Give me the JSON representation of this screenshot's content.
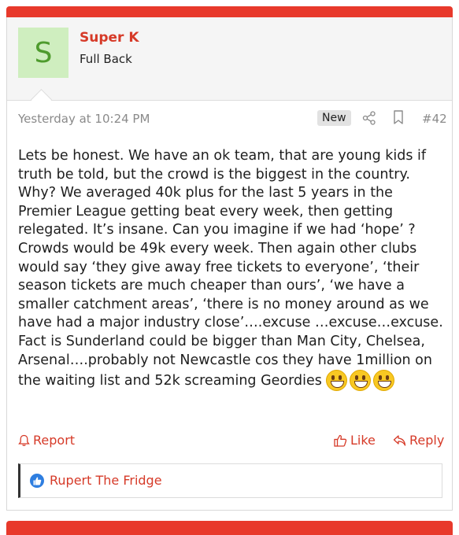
{
  "user": {
    "avatar_letter": "S",
    "name": "Super K",
    "title": "Full Back"
  },
  "meta": {
    "date": "Yesterday at 10:24 PM",
    "new_badge": "New",
    "post_number": "#42"
  },
  "post": {
    "body": "Lets be honest. We have an ok team, that are young kids if truth be told, but the crowd is the biggest in the country. Why? We averaged 40k plus for the last 5 years in the Premier League getting beat every week, then getting relegated. It’s insane. Can you imagine if we had ‘hope’ ? Crowds would be 49k every week. Then again other clubs would say ‘they give away free tickets to everyone’, ‘their season tickets are much cheaper than ours’, ‘we have a smaller catchment areas’, ‘there is no money around as we have had a major industry close’….excuse …excuse…excuse. Fact is Sunderland could be bigger than Man City, Chelsea, Arsenal….probably not Newcastle cos they have 1million on the waiting list and 52k screaming Geordies",
    "emoji_count": 3
  },
  "actions": {
    "report": "Report",
    "like": "Like",
    "reply": "Reply"
  },
  "reactions": {
    "users": "Rupert The Fridge"
  },
  "colors": {
    "accent": "#e8392b",
    "link": "#d63a28",
    "like_badge": "#2e7ee0"
  }
}
